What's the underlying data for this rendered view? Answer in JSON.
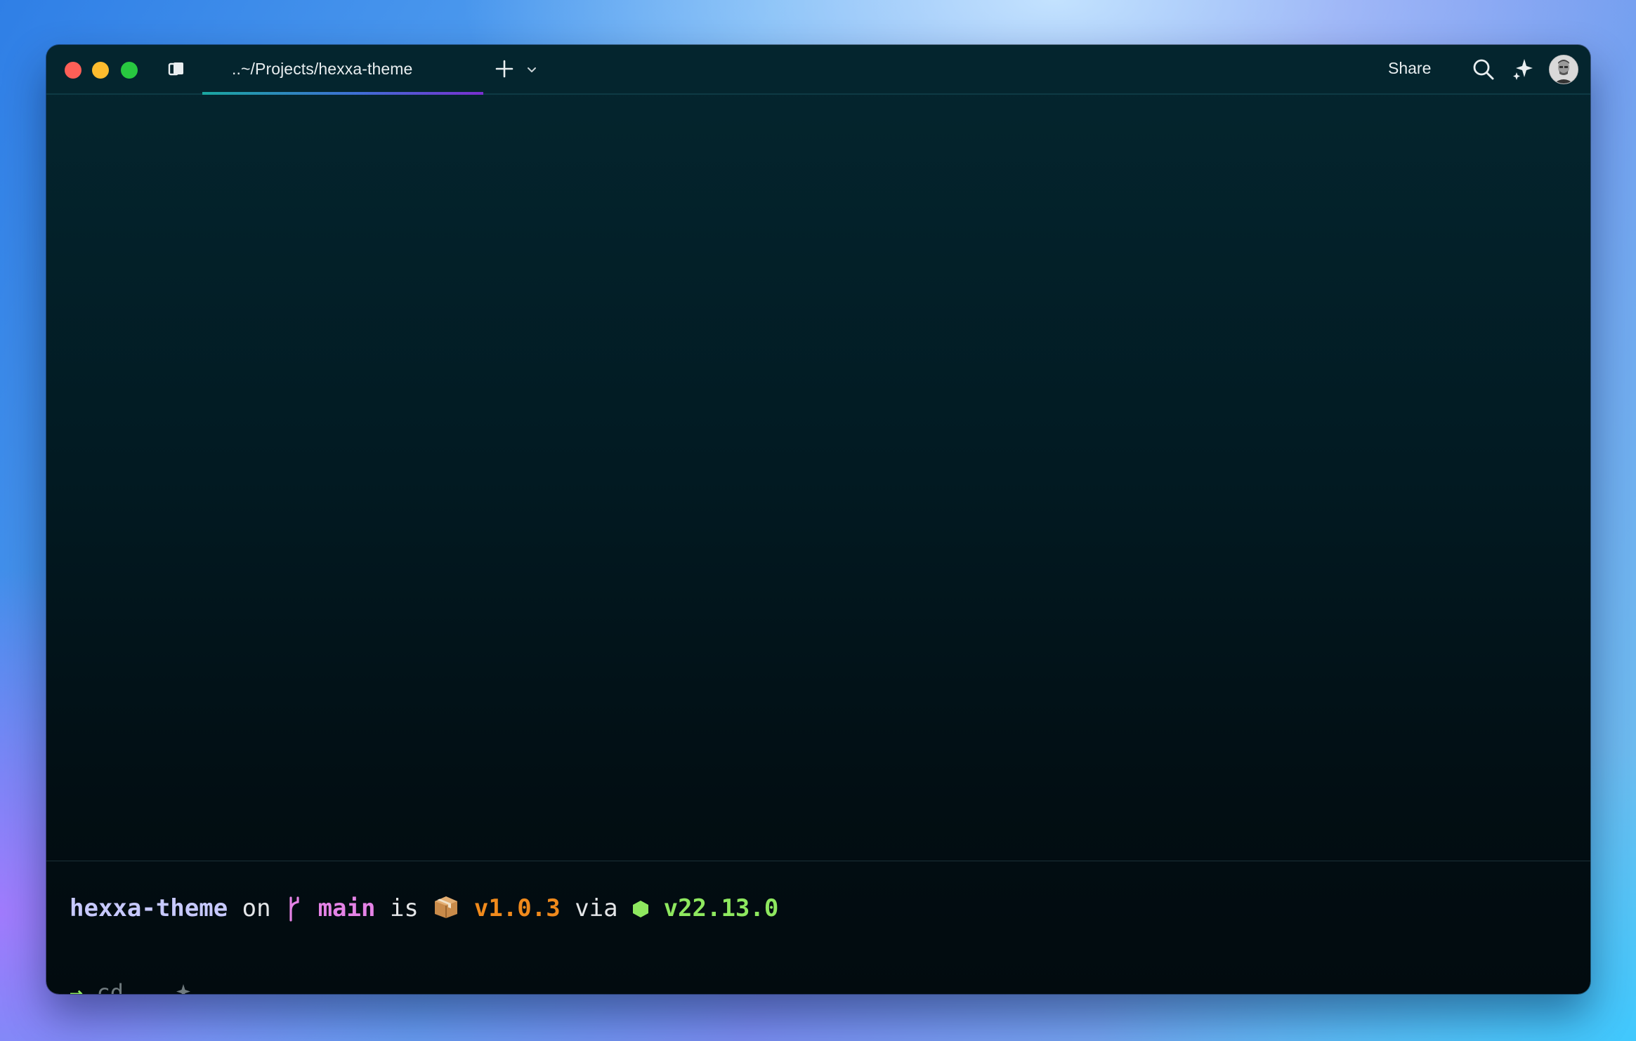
{
  "window": {
    "tab_title": "..~/Projects/hexxa-theme",
    "share_label": "Share"
  },
  "prompt": {
    "directory": "hexxa-theme",
    "on_word": "on",
    "branch": "main",
    "is_word": "is",
    "package_version": "v1.0.3",
    "via_word": "via",
    "node_version": "v22.13.0"
  },
  "input": {
    "arrow": "→",
    "command": "cd",
    "argument": ".."
  },
  "colors": {
    "close": "#fe5f57",
    "minimize": "#febc2e",
    "maximize": "#28c840",
    "directory": "#c7c9ff",
    "branch": "#e583e6",
    "package_version": "#f08a1c",
    "node_version": "#8ee85f"
  },
  "icons": [
    "close-icon",
    "minimize-icon",
    "maximize-icon",
    "panel-toggle-icon",
    "plus-icon",
    "chevron-down-icon",
    "search-icon",
    "sparkle-icon",
    "avatar",
    "git-branch-icon",
    "package-icon",
    "node-hex-icon"
  ]
}
